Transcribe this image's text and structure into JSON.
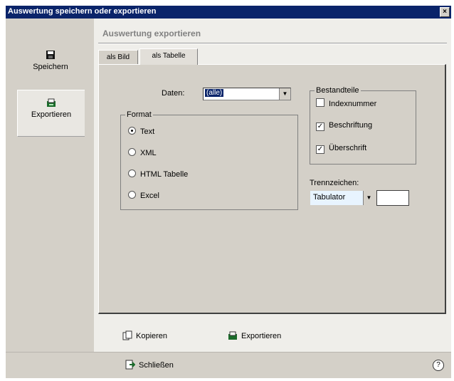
{
  "window": {
    "title": "Auswertung speichern oder exportieren",
    "close_glyph": "×"
  },
  "sidebar": {
    "items": [
      {
        "label": "Speichern",
        "icon": "save-icon",
        "active": false
      },
      {
        "label": "Exportieren",
        "icon": "export-icon",
        "active": true
      }
    ]
  },
  "main": {
    "heading": "Auswertung exportieren",
    "tabs": [
      {
        "label": "als Bild",
        "active": false
      },
      {
        "label": "als Tabelle",
        "active": true
      }
    ],
    "daten": {
      "label": "Daten:",
      "value": "(alle)",
      "highlight": "#0a246a"
    },
    "format": {
      "legend": "Format",
      "options": [
        {
          "label": "Text",
          "selected": true
        },
        {
          "label": "XML",
          "selected": false
        },
        {
          "label": "HTML Tabelle",
          "selected": false
        },
        {
          "label": "Excel",
          "selected": false
        }
      ]
    },
    "bestandteile": {
      "legend": "Bestandteile",
      "options": [
        {
          "label": "Indexnummer",
          "checked": false
        },
        {
          "label": "Beschriftung",
          "checked": true
        },
        {
          "label": "Überschrift",
          "checked": true
        }
      ]
    },
    "trennzeichen": {
      "label": "Trennzeichen:",
      "value": "Tabulator",
      "value_bg": "#e8f4ff"
    }
  },
  "actions": {
    "copy": {
      "label": "Kopieren",
      "icon": "copy-icon"
    },
    "export": {
      "label": "Exportieren",
      "icon": "export-icon"
    }
  },
  "footer": {
    "close": {
      "label": "Schließen",
      "icon": "close-door-icon"
    },
    "help_glyph": "?"
  }
}
